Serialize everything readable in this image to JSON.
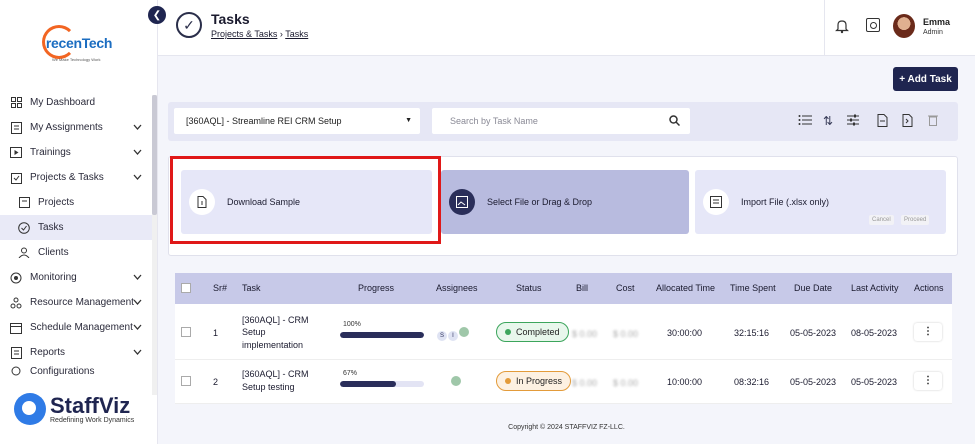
{
  "logo": {
    "text": "recenTech",
    "tagline": "We Make Technology Work"
  },
  "sidebar": {
    "items": [
      {
        "label": "My Dashboard",
        "icon": "dashboard-icon"
      },
      {
        "label": "My Assignments",
        "icon": "assignments-icon"
      },
      {
        "label": "Trainings",
        "icon": "trainings-icon"
      },
      {
        "label": "Projects & Tasks",
        "icon": "projects-icon"
      },
      {
        "label": "Projects",
        "icon": "project-icon"
      },
      {
        "label": "Tasks",
        "icon": "tasks-icon"
      },
      {
        "label": "Clients",
        "icon": "clients-icon"
      },
      {
        "label": "Monitoring",
        "icon": "monitoring-icon"
      },
      {
        "label": "Resource Management",
        "icon": "resource-icon"
      },
      {
        "label": "Schedule Management",
        "icon": "schedule-icon"
      },
      {
        "label": "Reports",
        "icon": "reports-icon"
      },
      {
        "label": "Configurations",
        "icon": "config-icon"
      }
    ]
  },
  "brand": {
    "name": "StaffViz",
    "tagline": "Redefining Work Dynamics"
  },
  "header": {
    "title": "Tasks",
    "breadcrumb": [
      "Projects & Tasks",
      "Tasks"
    ],
    "user": {
      "name": "Emma",
      "role": "Admin"
    }
  },
  "toolbar": {
    "add_task": "+ Add Task",
    "project_select": "[360AQL] - Streamline REI CRM Setup",
    "search_placeholder": "Search by Task Name"
  },
  "import": {
    "download": "Download Sample",
    "upload": "Select File or Drag & Drop",
    "import_file": "Import File (.xlsx only)",
    "cancel": "Cancel",
    "proceed": "Proceed"
  },
  "table": {
    "headers": [
      "Sr#",
      "Task",
      "Progress",
      "Assignees",
      "Status",
      "Bill",
      "Cost",
      "Allocated Time",
      "Time Spent",
      "Due Date",
      "Last Activity",
      "Actions"
    ],
    "rows": [
      {
        "sr": "1",
        "task_l1": "[360AQL] - CRM",
        "task_l2": "Setup",
        "task_l3": "implementation",
        "progress_label": "100%",
        "progress": 1.0,
        "assignees": [
          "S",
          "I"
        ],
        "status": "Completed",
        "bill": "$ 0.00",
        "cost": "$ 0.00",
        "allocated": "30:00:00",
        "spent": "32:15:16",
        "due": "05-05-2023",
        "last": "08-05-2023"
      },
      {
        "sr": "2",
        "task_l1": "[360AQL] - CRM",
        "task_l2": "Setup testing",
        "task_l3": "",
        "progress_label": "67%",
        "progress": 0.67,
        "assignees": [],
        "status": "In Progress",
        "bill": "$ 0.00",
        "cost": "$ 0.00",
        "allocated": "10:00:00",
        "spent": "08:32:16",
        "due": "05-05-2023",
        "last": "05-05-2023"
      }
    ]
  },
  "footer": "Copyright © 2024 STAFFVIZ FZ-LLC."
}
